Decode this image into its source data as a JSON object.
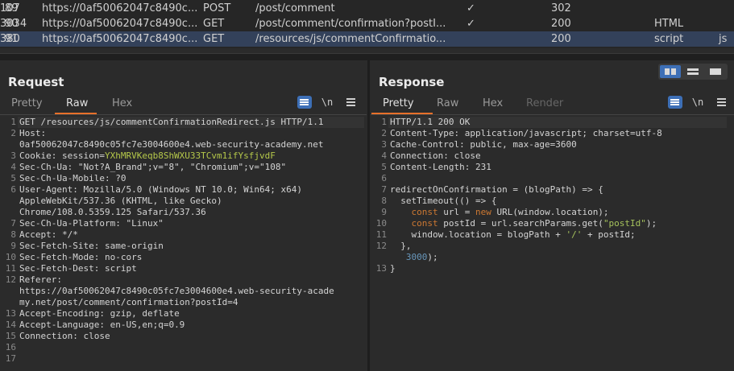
{
  "history": {
    "rows": [
      {
        "num": "89",
        "host": "https://0af50062047c8490c...",
        "method": "POST",
        "url": "/post/comment",
        "check": "✓",
        "status": "302",
        "length": "107",
        "mime": "",
        "ext": ""
      },
      {
        "num": "90",
        "host": "https://0af50062047c8490c...",
        "method": "GET",
        "url": "/post/comment/confirmation?postI...",
        "check": "✓",
        "status": "200",
        "length": "3034",
        "mime": "HTML",
        "ext": ""
      },
      {
        "num": "91",
        "host": "https://0af50062047c8490c...",
        "method": "GET",
        "url": "/resources/js/commentConfirmatio...",
        "check": "",
        "status": "200",
        "length": "380",
        "mime": "script",
        "ext": "js"
      }
    ]
  },
  "request": {
    "title": "Request",
    "tabs": [
      "Pretty",
      "Raw",
      "Hex"
    ],
    "active_tab": "Raw",
    "newline_label": "\\n",
    "lines": [
      {
        "n": "1",
        "segs": [
          [
            "GET /resources/js/commentConfirmationRedirect.js HTTP/1.1",
            "hname"
          ]
        ]
      },
      {
        "n": "2",
        "segs": [
          [
            "Host:",
            "hname"
          ]
        ]
      },
      {
        "n": "",
        "segs": [
          [
            "0af50062047c8490c05fc7e3004600e4.web-security-academy.net",
            "hval"
          ]
        ]
      },
      {
        "n": "3",
        "segs": [
          [
            "Cookie: ",
            "hname"
          ],
          [
            "session=",
            "hname"
          ],
          [
            "YXhMRVKeqb8ShWXU33TCvm1ifYsfjvdF",
            "cookie-val"
          ]
        ]
      },
      {
        "n": "4",
        "segs": [
          [
            "Sec-Ch-Ua: ",
            "hname"
          ],
          [
            "\"Not?A_Brand\";v=\"8\", \"Chromium\";v=\"108\"",
            "hval"
          ]
        ]
      },
      {
        "n": "5",
        "segs": [
          [
            "Sec-Ch-Ua-Mobile: ",
            "hname"
          ],
          [
            "?0",
            "hval"
          ]
        ]
      },
      {
        "n": "6",
        "segs": [
          [
            "User-Agent: ",
            "hname"
          ],
          [
            "Mozilla/5.0 (Windows NT 10.0; Win64; x64)",
            "hval"
          ]
        ]
      },
      {
        "n": "",
        "segs": [
          [
            "AppleWebKit/537.36 (KHTML, like Gecko)",
            "hval"
          ]
        ]
      },
      {
        "n": "",
        "segs": [
          [
            "Chrome/108.0.5359.125 Safari/537.36",
            "hval"
          ]
        ]
      },
      {
        "n": "7",
        "segs": [
          [
            "Sec-Ch-Ua-Platform: ",
            "hname"
          ],
          [
            "\"Linux\"",
            "hval"
          ]
        ]
      },
      {
        "n": "8",
        "segs": [
          [
            "Accept: ",
            "hname"
          ],
          [
            "*/*",
            "hval"
          ]
        ]
      },
      {
        "n": "9",
        "segs": [
          [
            "Sec-Fetch-Site: ",
            "hname"
          ],
          [
            "same-origin",
            "hval"
          ]
        ]
      },
      {
        "n": "10",
        "segs": [
          [
            "Sec-Fetch-Mode: ",
            "hname"
          ],
          [
            "no-cors",
            "hval"
          ]
        ]
      },
      {
        "n": "11",
        "segs": [
          [
            "Sec-Fetch-Dest: ",
            "hname"
          ],
          [
            "script",
            "hval"
          ]
        ]
      },
      {
        "n": "12",
        "segs": [
          [
            "Referer:",
            "hname"
          ]
        ]
      },
      {
        "n": "",
        "segs": [
          [
            "https://0af50062047c8490c05fc7e3004600e4.web-security-acade",
            "hval"
          ]
        ]
      },
      {
        "n": "",
        "segs": [
          [
            "my.net/post/comment/confirmation?postId=4",
            "hval"
          ]
        ]
      },
      {
        "n": "13",
        "segs": [
          [
            "Accept-Encoding: ",
            "hname"
          ],
          [
            "gzip, deflate",
            "hval"
          ]
        ]
      },
      {
        "n": "14",
        "segs": [
          [
            "Accept-Language: ",
            "hname"
          ],
          [
            "en-US,en;q=0.9",
            "hval"
          ]
        ]
      },
      {
        "n": "15",
        "segs": [
          [
            "Connection: ",
            "hname"
          ],
          [
            "close",
            "hval"
          ]
        ]
      },
      {
        "n": "16",
        "segs": []
      },
      {
        "n": "17",
        "segs": []
      }
    ]
  },
  "response": {
    "title": "Response",
    "tabs": [
      "Pretty",
      "Raw",
      "Hex",
      "Render"
    ],
    "active_tab": "Pretty",
    "newline_label": "\\n",
    "lines": [
      {
        "n": "1",
        "segs": [
          [
            "HTTP/1.1 200 OK",
            "hname"
          ]
        ]
      },
      {
        "n": "2",
        "segs": [
          [
            "Content-Type: ",
            "hname"
          ],
          [
            "application/javascript; charset=utf-8",
            "hval"
          ]
        ]
      },
      {
        "n": "3",
        "segs": [
          [
            "Cache-Control: ",
            "hname"
          ],
          [
            "public, max-age=3600",
            "hval"
          ]
        ]
      },
      {
        "n": "4",
        "segs": [
          [
            "Connection: ",
            "hname"
          ],
          [
            "close",
            "hval"
          ]
        ]
      },
      {
        "n": "5",
        "segs": [
          [
            "Content-Length: ",
            "hname"
          ],
          [
            "231",
            "hval"
          ]
        ]
      },
      {
        "n": "6",
        "segs": []
      },
      {
        "n": "7",
        "segs": [
          [
            "redirectOnConfirmation = (blogPath) => {",
            "hval"
          ]
        ]
      },
      {
        "n": "8",
        "segs": [
          [
            "  setTimeout(() => {",
            "hval"
          ]
        ]
      },
      {
        "n": "9",
        "segs": [
          [
            "    ",
            "hval"
          ],
          [
            "const",
            "kw"
          ],
          [
            " url = ",
            "hval"
          ],
          [
            "new",
            "kw"
          ],
          [
            " URL(window.location);",
            "hval"
          ]
        ]
      },
      {
        "n": "10",
        "segs": [
          [
            "    ",
            "hval"
          ],
          [
            "const",
            "kw"
          ],
          [
            " postId = url.searchParams.get(",
            "hval"
          ],
          [
            "\"postId\"",
            "str"
          ],
          [
            ");",
            "hval"
          ]
        ]
      },
      {
        "n": "11",
        "segs": [
          [
            "    window.location = blogPath + ",
            "hval"
          ],
          [
            "'/'",
            "str"
          ],
          [
            " + postId;",
            "hval"
          ]
        ]
      },
      {
        "n": "12",
        "segs": [
          [
            "  },",
            "hval"
          ]
        ]
      },
      {
        "n": "",
        "segs": [
          [
            "   ",
            "hval"
          ],
          [
            "3000",
            "num"
          ],
          [
            ");",
            "hval"
          ]
        ]
      },
      {
        "n": "13",
        "segs": [
          [
            "}",
            "hval"
          ]
        ]
      }
    ]
  }
}
